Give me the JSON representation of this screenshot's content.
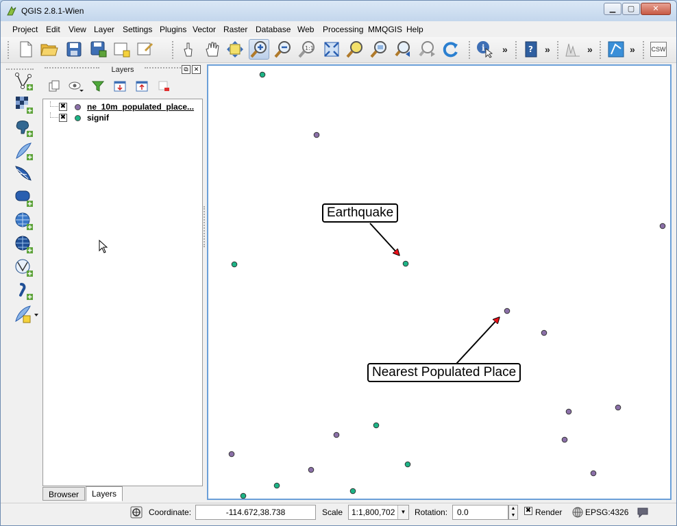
{
  "window": {
    "title": "QGIS 2.8.1-Wien"
  },
  "menu": [
    "Project",
    "Edit",
    "View",
    "Layer",
    "Settings",
    "Plugins",
    "Vector",
    "Raster",
    "Database",
    "Web",
    "Processing",
    "MMQGIS",
    "Help"
  ],
  "toolbar": {
    "overflow_glyph": "»",
    "csw_label": "CSW"
  },
  "layers_panel": {
    "title": "Layers",
    "layers": [
      {
        "name": "ne_10m_populated_place...",
        "checked": "✖",
        "color": "#8b70a8"
      },
      {
        "name": "signif",
        "checked": "✖",
        "color": "#1db486"
      }
    ],
    "tabs": [
      "Browser",
      "Layers"
    ]
  },
  "map": {
    "callouts": {
      "earthquake": "Earthquake",
      "nearest": "Nearest Populated Place"
    },
    "arrow_color": "#e8101a"
  },
  "status": {
    "coordinate_label": "Coordinate:",
    "coordinate_value": "-114.672,38.738",
    "scale_label": "Scale",
    "scale_value": "1:1,800,702",
    "rotation_label": "Rotation:",
    "rotation_value": "0.0",
    "render_label": "Render",
    "render_checked": "✖",
    "crs": "EPSG:4326"
  }
}
